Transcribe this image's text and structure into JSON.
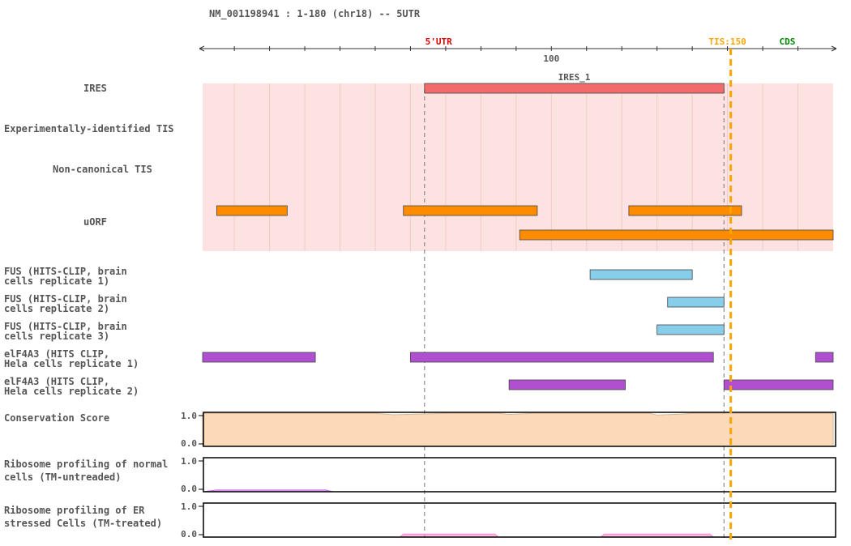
{
  "header": {
    "title": "NM_001198941 : 1-180 (chr18) -- 5UTR"
  },
  "colors": {
    "shade": "#fde2e2",
    "ires": "#f26b6b",
    "uorf": "#ff8c00",
    "fus": "#87ceeb",
    "elf": "#b050d0",
    "tis": "#ffa500",
    "utr": "#dd0000",
    "cds": "#008800",
    "cons_fill": "#fcd9b8",
    "ribo_normal": "#cc66ee",
    "ribo_er": "#ff88cc",
    "grid": "#f0caca"
  },
  "chart_data": {
    "type": "genome_track",
    "x_range": [
      1,
      180
    ],
    "ticks": {
      "major": 100,
      "minor_step": 10
    },
    "markers": [
      {
        "name": "5'UTR",
        "pos": 68
      },
      {
        "name": "TIS:150",
        "pos": 150
      },
      {
        "name": "CDS",
        "pos": 167
      }
    ],
    "tis_pos": 150,
    "ires_span": [
      64,
      149
    ],
    "tracks": [
      {
        "label": [
          "IRES"
        ],
        "kind": "bar",
        "color_key": "ires",
        "features": [
          {
            "start": 64,
            "end": 149,
            "name": "IRES_1"
          }
        ]
      },
      {
        "label": [
          "Experimentally-identified TIS"
        ],
        "kind": "bar",
        "color_key": "uorf",
        "features": []
      },
      {
        "label": [
          "Non-canonical TIS"
        ],
        "kind": "bar",
        "color_key": "uorf",
        "features": []
      },
      {
        "label": [
          "uORF"
        ],
        "kind": "bar",
        "color_key": "uorf",
        "features": [
          {
            "start": 5,
            "end": 25
          },
          {
            "start": 58,
            "end": 96
          },
          {
            "start": 122,
            "end": 154
          },
          {
            "start": 91,
            "end": 180
          }
        ]
      },
      {
        "label": [
          "FUS (HITS-CLIP, brain",
          "cells replicate 1)"
        ],
        "kind": "bar",
        "color_key": "fus",
        "features": [
          {
            "start": 111,
            "end": 140
          }
        ]
      },
      {
        "label": [
          "FUS (HITS-CLIP, brain",
          "cells replicate 2)"
        ],
        "kind": "bar",
        "color_key": "fus",
        "features": [
          {
            "start": 133,
            "end": 149
          }
        ]
      },
      {
        "label": [
          "FUS (HITS-CLIP, brain",
          "cells replicate 3)"
        ],
        "kind": "bar",
        "color_key": "fus",
        "features": [
          {
            "start": 130,
            "end": 149
          }
        ]
      },
      {
        "label": [
          "elF4A3 (HITS CLIP,",
          "Hela cells replicate 1)"
        ],
        "kind": "bar",
        "color_key": "elf",
        "features": [
          {
            "start": 1,
            "end": 33
          },
          {
            "start": 60,
            "end": 146
          },
          {
            "start": 175,
            "end": 180
          }
        ]
      },
      {
        "label": [
          "elF4A3 (HITS CLIP,",
          "Hela cells replicate 2)"
        ],
        "kind": "bar",
        "color_key": "elf",
        "features": [
          {
            "start": 88,
            "end": 121
          },
          {
            "start": 149,
            "end": 180
          }
        ]
      },
      {
        "label": [
          "Conservation Score"
        ],
        "kind": "signal",
        "color_key": "cons_fill",
        "ymax_label": "1.0",
        "ymin_label": "0.0",
        "x": [
          1,
          50,
          55,
          70,
          85,
          88,
          95,
          128,
          130,
          137,
          140,
          180
        ],
        "values": [
          0.97,
          0.97,
          0.93,
          0.97,
          0.97,
          0.94,
          0.97,
          0.97,
          0.92,
          0.95,
          0.97,
          0.97
        ]
      },
      {
        "label": [
          "Ribosome profiling of normal",
          "cells (TM-untreaded)"
        ],
        "kind": "signal",
        "color_key": "ribo_normal",
        "ymax_label": "1.0",
        "ymin_label": "0.0",
        "x": [
          1,
          5,
          36,
          38,
          175,
          180
        ],
        "values": [
          0.0,
          0.05,
          0.05,
          0.0,
          0.0,
          0.0
        ]
      },
      {
        "label": [
          "Ribosome profiling of ER",
          "stressed Cells (TM-treated)"
        ],
        "kind": "signal",
        "color_key": "ribo_er",
        "ymax_label": "1.0",
        "ymin_label": "0.0",
        "x": [
          1,
          57,
          58,
          84,
          85,
          114,
          115,
          145,
          146,
          180
        ],
        "values": [
          0.0,
          0.0,
          0.09,
          0.09,
          0.0,
          0.0,
          0.09,
          0.09,
          0.0,
          0.0
        ]
      }
    ]
  }
}
